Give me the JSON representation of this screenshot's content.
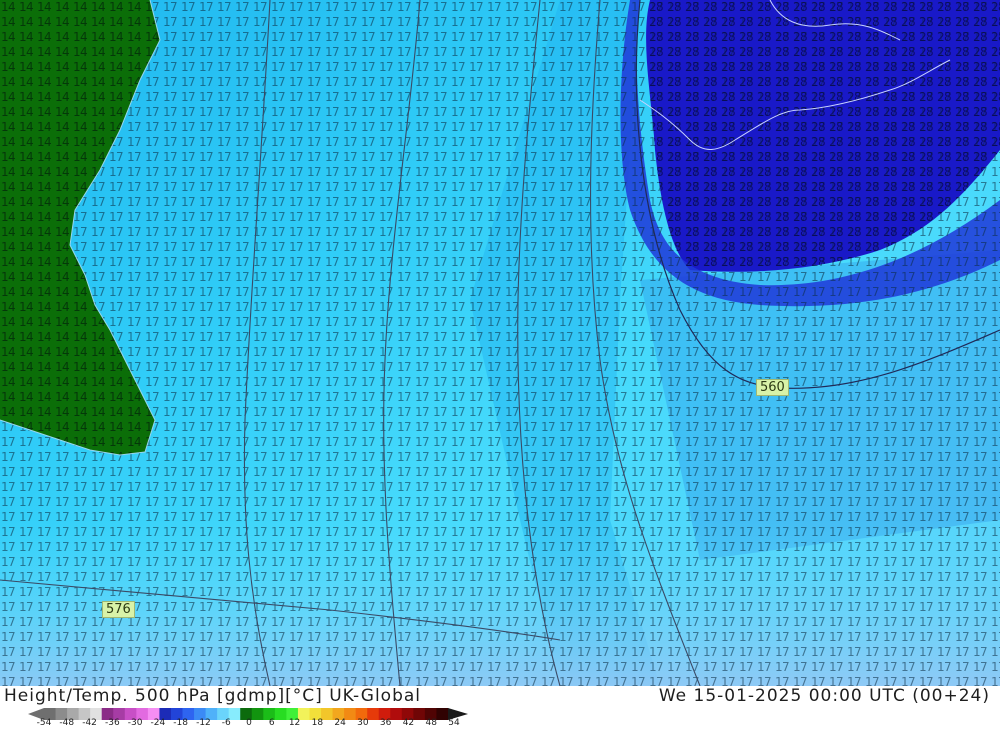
{
  "title": "Height/Temp. 500 hPa [gdmp][°C] UK-Global",
  "datetime": "We 15-01-2025 00:00 UTC (00+24)",
  "labels": {
    "contour_high": "576",
    "contour_low": "560"
  },
  "legend": {
    "ticks": [
      "-54",
      "-48",
      "-42",
      "-36",
      "-30",
      "-24",
      "-18",
      "-12",
      "-6",
      "0",
      "6",
      "12",
      "18",
      "24",
      "30",
      "36",
      "42",
      "48",
      "54"
    ],
    "colors": [
      "#6f6f6f",
      "#8c8c8c",
      "#a9a9a9",
      "#c6c6c6",
      "#e1e1e1",
      "#8b2c87",
      "#a73ca5",
      "#c84fc6",
      "#e26ae0",
      "#f58ef3",
      "#1c2bb7",
      "#2244d8",
      "#2e64f0",
      "#3b8af5",
      "#4fb1f9",
      "#6ad4fb",
      "#87ecfd",
      "#0c6b0d",
      "#12940f",
      "#1bbd18",
      "#28dc22",
      "#40f038",
      "#f2f25a",
      "#f2e03a",
      "#f2c62a",
      "#f2a71e",
      "#f28a14",
      "#f26a0c",
      "#e63a0a",
      "#d01c0c",
      "#b00c0c",
      "#900808",
      "#700606",
      "#500404",
      "#300202"
    ],
    "arrow_color": "#1a1a1a"
  },
  "map": {
    "land_color": "#0b6e08",
    "cold_core_color": "#1919c8",
    "ocean_shades": [
      "#1fb4ee",
      "#2ac6f6",
      "#3ad4fb",
      "#55e0fd",
      "#6ce6fd",
      "#86dcfb",
      "#9ad0f6"
    ]
  }
}
